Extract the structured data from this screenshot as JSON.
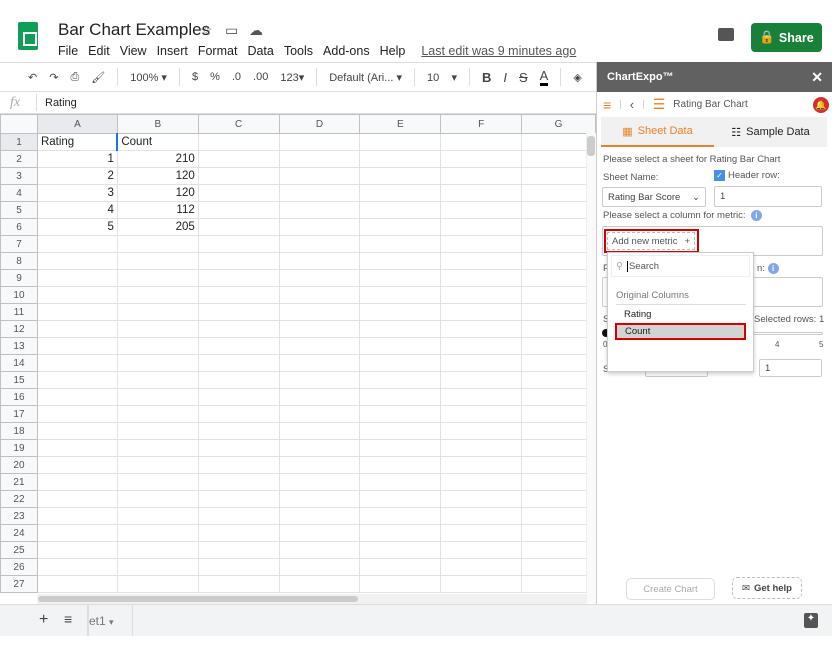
{
  "header": {
    "title": "Bar Chart Examples",
    "menu": [
      "File",
      "Edit",
      "View",
      "Insert",
      "Format",
      "Data",
      "Tools",
      "Add-ons",
      "Help"
    ],
    "last_edit": "Last edit was 9 minutes ago",
    "share": "Share"
  },
  "toolbar": {
    "zoom": "100%",
    "currency": "$",
    "percent": "%",
    "dec_dec": ".0",
    "inc_dec": ".00",
    "format": "123",
    "font": "Default (Ari...",
    "size": "10",
    "bold": "B",
    "italic": "I",
    "strike": "S",
    "textcolor": "A"
  },
  "formula": {
    "fx": "fx",
    "value": "Rating"
  },
  "grid": {
    "columns": [
      "A",
      "B",
      "C",
      "D",
      "E",
      "F",
      "G"
    ],
    "rows": [
      [
        "Rating",
        "Count"
      ],
      [
        "1",
        "210"
      ],
      [
        "2",
        "120"
      ],
      [
        "3",
        "120"
      ],
      [
        "4",
        "112"
      ],
      [
        "5",
        "205"
      ]
    ],
    "row_count": 27
  },
  "sheets": {
    "tab": "et1"
  },
  "sidebar": {
    "title": "ChartExpo™",
    "chart_name": "Rating Bar Chart",
    "tabs": [
      "Sheet Data",
      "Sample Data"
    ],
    "select_sheet": "Please select a sheet for Rating Bar Chart",
    "sheet_name_label": "Sheet Name:",
    "sheet_name": "Rating Bar Score",
    "header_row_label": "Header row:",
    "header_row": "1",
    "header_row_checked": true,
    "metric_label": "Please select a column for metric:",
    "add_metric": "Add new metric",
    "plus": "+",
    "hidden_label_p": "P",
    "hidden_label_n": "n:",
    "selected_rows": "Selected rows: 1",
    "slider_ticks": [
      "0",
      "4",
      "5"
    ],
    "s_label": "S",
    "s_label2": "S",
    "end_value": "1",
    "dropdown": {
      "placeholder": "Search",
      "group": "Original Columns",
      "items": [
        "Rating",
        "Count"
      ],
      "highlighted": "Count"
    },
    "create_chart": "Create Chart",
    "get_help": "Get help"
  },
  "colors": {
    "accent": "#e8822a",
    "share": "#188038",
    "highlight": "#d40000"
  }
}
